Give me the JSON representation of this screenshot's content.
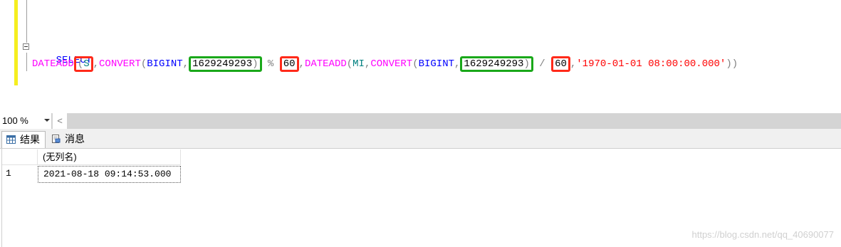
{
  "editor": {
    "line1": "SELECT",
    "line2": {
      "t1": "DATEADD",
      "t2": "(",
      "t3": "S",
      "t4": ",",
      "t5": "CONVERT",
      "t6": "(",
      "t7": "BIGINT",
      "t8": ",",
      "t9": "1629249293",
      "t10": ")",
      "t11": " % ",
      "t12": "60",
      "t13": ",",
      "t14": "DATEADD",
      "t15": "(",
      "t16": "MI",
      "t17": ",",
      "t18": "CONVERT",
      "t19": "(",
      "t20": "BIGINT",
      "t21": ",",
      "t22": "1629249293",
      "t23": ")",
      "t24": " / ",
      "t25": "60",
      "t26": ",",
      "t27": "'1970-01-01 08:00:00.000'",
      "t28": "))"
    }
  },
  "status": {
    "zoom": "100 %",
    "scroll_left": "<"
  },
  "tabs": {
    "results": "结果",
    "messages": "消息"
  },
  "grid": {
    "column_header": "(无列名)",
    "rows": [
      {
        "num": "1",
        "value": "2021-08-18 09:14:53.000"
      }
    ]
  },
  "watermark": "https://blog.csdn.net/qq_40690077",
  "colors": {
    "keyword": "#0000ff",
    "function": "#ff00ff",
    "string": "#ff0000",
    "highlight_red": "#ff2a1a",
    "highlight_green": "#1aa81a"
  }
}
